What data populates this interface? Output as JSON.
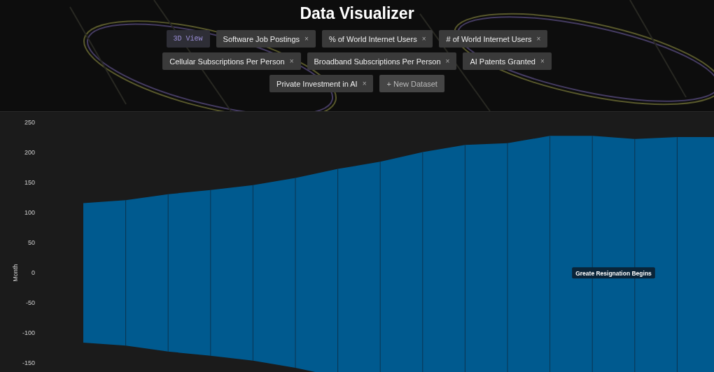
{
  "header": {
    "title": "Data Visualizer",
    "tab_rows": [
      [
        {
          "label": "3D View",
          "kind": "view"
        },
        {
          "label": "Software Job Postings",
          "kind": "dataset",
          "close": "×"
        },
        {
          "label": "% of World Internet Users",
          "kind": "dataset",
          "close": "×"
        },
        {
          "label": "# of World Internet Users",
          "kind": "dataset",
          "close": "×"
        }
      ],
      [
        {
          "label": "Cellular Subscriptions Per Person",
          "kind": "dataset",
          "close": "×"
        },
        {
          "label": "Broadband Subscriptions Per Person",
          "kind": "dataset",
          "close": "×"
        },
        {
          "label": "AI Patents Granted",
          "kind": "dataset",
          "close": "×"
        }
      ],
      [
        {
          "label": "Private Investment in AI",
          "kind": "dataset",
          "close": "×"
        },
        {
          "label": "+ New Dataset",
          "kind": "add"
        }
      ]
    ]
  },
  "chart": {
    "y_axis": {
      "title": "Month",
      "ticks": [
        "250",
        "200",
        "150",
        "100",
        "50",
        "0",
        "-50",
        "-100",
        "-150"
      ]
    },
    "annotation": {
      "text": "Greate Resignation Begins"
    }
  }
}
